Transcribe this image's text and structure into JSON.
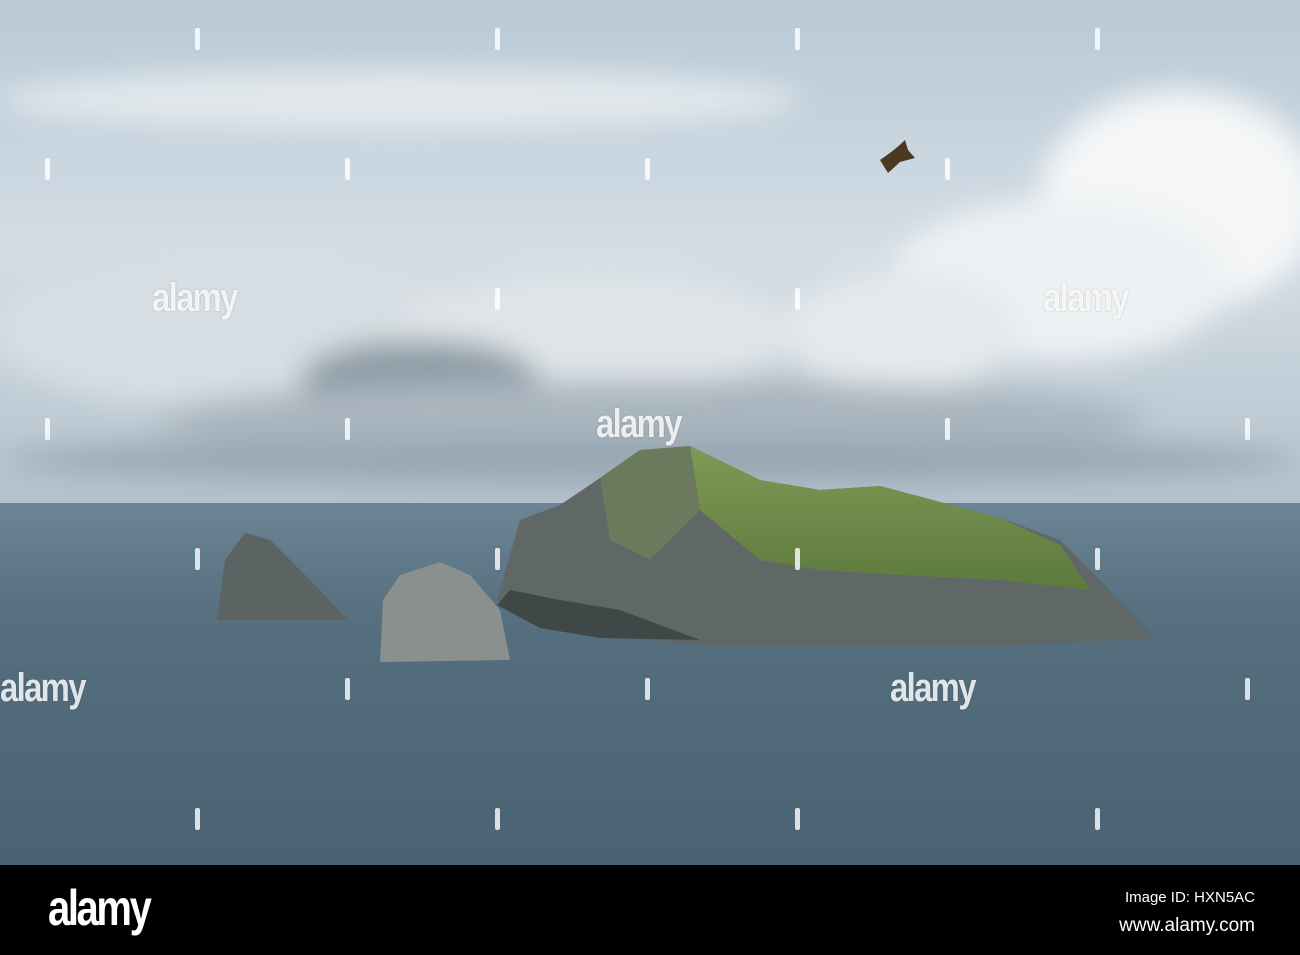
{
  "watermark": {
    "text": "alamy"
  },
  "footer": {
    "logo": "alamy",
    "image_id": "Image ID: HXN5AC",
    "url": "www.alamy.com"
  },
  "colors": {
    "sky": "#c9d6e0",
    "sea": "#4e6677",
    "island_green": "#6f8a48",
    "rock": "#5c6564"
  }
}
